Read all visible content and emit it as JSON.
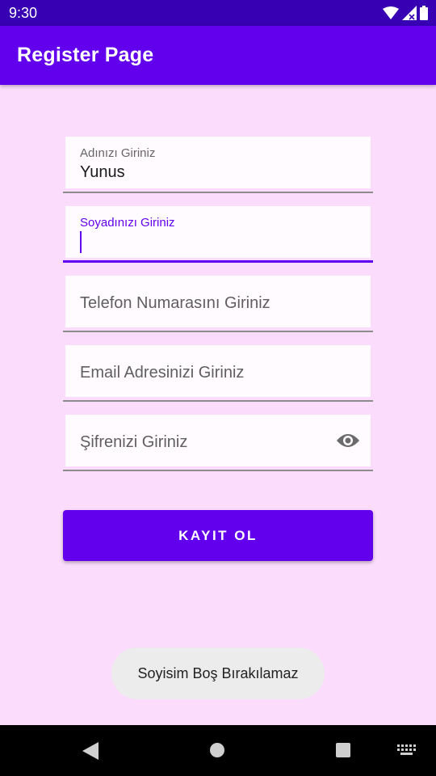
{
  "status_bar": {
    "time": "9:30"
  },
  "app_bar": {
    "title": "Register Page"
  },
  "form": {
    "first_name": {
      "label": "Adınızı Giriniz",
      "value": "Yunus"
    },
    "last_name": {
      "label": "Soyadınızı Giriniz",
      "value": ""
    },
    "phone": {
      "placeholder": "Telefon Numarasını Giriniz"
    },
    "email": {
      "placeholder": "Email Adresinizi Giriniz"
    },
    "password": {
      "placeholder": "Şifrenizi Giriniz",
      "toggle_icon": "eye-icon"
    }
  },
  "register_button": {
    "label": "KAYIT OL"
  },
  "toast": {
    "message": "Soyisim Boş Bırakılamaz"
  },
  "colors": {
    "primary": "#6200ee",
    "primary_dark": "#3700b3",
    "background": "#fbdcfd",
    "field_background": "#fffbff"
  },
  "nav_bar": {
    "icons": [
      "back-icon",
      "home-icon",
      "recents-icon",
      "keyboard-icon"
    ]
  }
}
